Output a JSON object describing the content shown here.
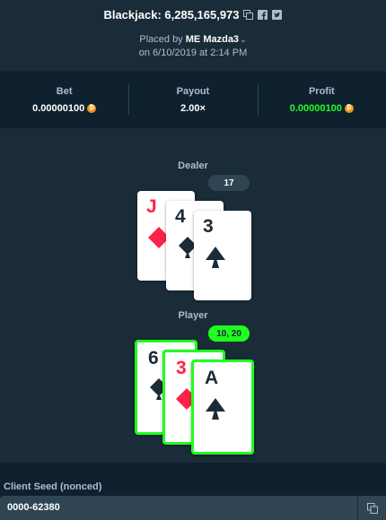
{
  "header": {
    "title": "Blackjack: 6,285,165,973",
    "placed_by_prefix": "Placed by",
    "user_badge": "ME",
    "username": "Mazda3",
    "date_text": "on 6/10/2019 at 2:14 PM"
  },
  "stats": [
    {
      "label": "Bet",
      "value": "0.00000100",
      "currency_icon": "btc-icon"
    },
    {
      "label": "Payout",
      "value": "2.00×"
    },
    {
      "label": "Profit",
      "value": "0.00000100",
      "currency_icon": "btc-icon",
      "color": "#1fff20"
    }
  ],
  "dealer": {
    "label": "Dealer",
    "score": "17",
    "cards": [
      {
        "rank": "J",
        "suit": "diamond"
      },
      {
        "rank": "4",
        "suit": "club"
      },
      {
        "rank": "3",
        "suit": "spade"
      }
    ]
  },
  "player": {
    "label": "Player",
    "score": "10, 20",
    "cards": [
      {
        "rank": "6",
        "suit": "club"
      },
      {
        "rank": "3",
        "suit": "diamond"
      },
      {
        "rank": "A",
        "suit": "spade"
      }
    ]
  },
  "client_seed": {
    "label": "Client Seed (nonced)",
    "value": "0000-62380"
  },
  "colors": {
    "background": "#1a2c38",
    "panel": "#0f212e",
    "win_green": "#1fff20",
    "red_suit": "#fe2247"
  }
}
